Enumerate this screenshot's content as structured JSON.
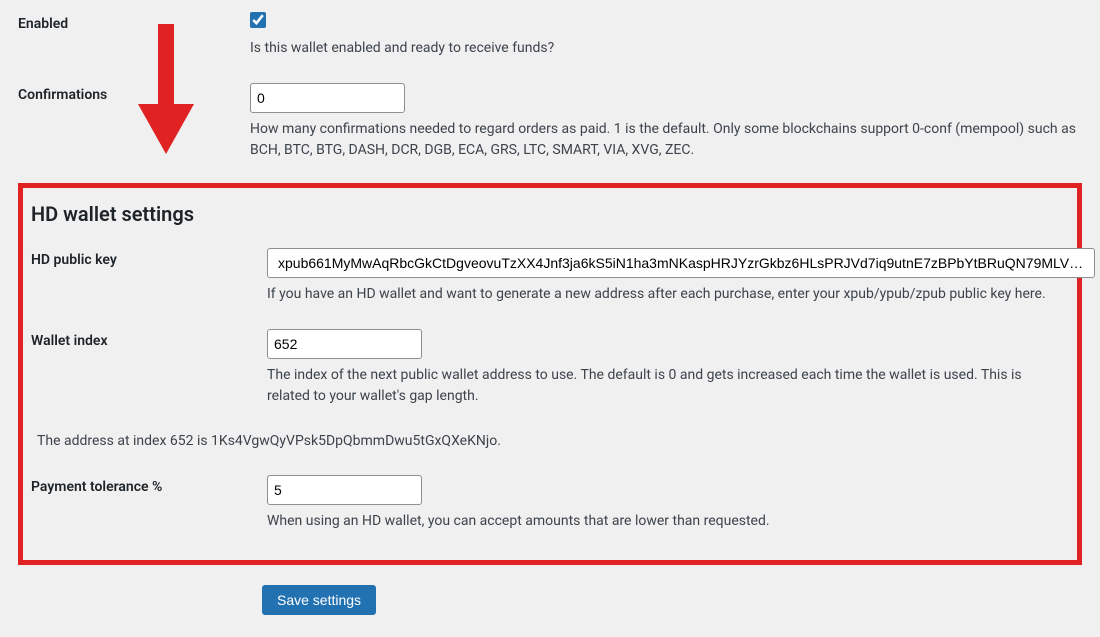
{
  "enabled": {
    "label": "Enabled",
    "checked": true,
    "desc": "Is this wallet enabled and ready to receive funds?"
  },
  "confirmations": {
    "label": "Confirmations",
    "value": "0",
    "desc": "How many confirmations needed to regard orders as paid. 1 is the default. Only some blockchains support 0-conf (mempool) such as BCH, BTC, BTG, DASH, DCR, DGB, ECA, GRS, LTC, SMART, VIA, XVG, ZEC."
  },
  "hd_section": {
    "title": "HD wallet settings",
    "public_key": {
      "label": "HD public key",
      "value": "xpub661MyMwAqRbcGkCtDgveovuTzXX4Jnf3ja6kS5iN1ha3mNKaspHRJYzrGkbz6HLsPRJVd7iq9utnE7zBPbYtBRuQN79MLVJ…",
      "desc": "If you have an HD wallet and want to generate a new address after each purchase, enter your xpub/ypub/zpub public key here."
    },
    "wallet_index": {
      "label": "Wallet index",
      "value": "652",
      "desc": "The index of the next public wallet address to use. The default is 0 and gets increased each time the wallet is used. This is related to your wallet's gap length."
    },
    "address_note": "The address at index 652 is 1Ks4VgwQyVPsk5DpQbmmDwu5tGxQXeKNjo.",
    "tolerance": {
      "label": "Payment tolerance %",
      "value": "5",
      "desc": "When using an HD wallet, you can accept amounts that are lower than requested."
    }
  },
  "save_button": "Save settings",
  "colors": {
    "accent_red": "#e02222",
    "primary_blue": "#2271b1"
  }
}
